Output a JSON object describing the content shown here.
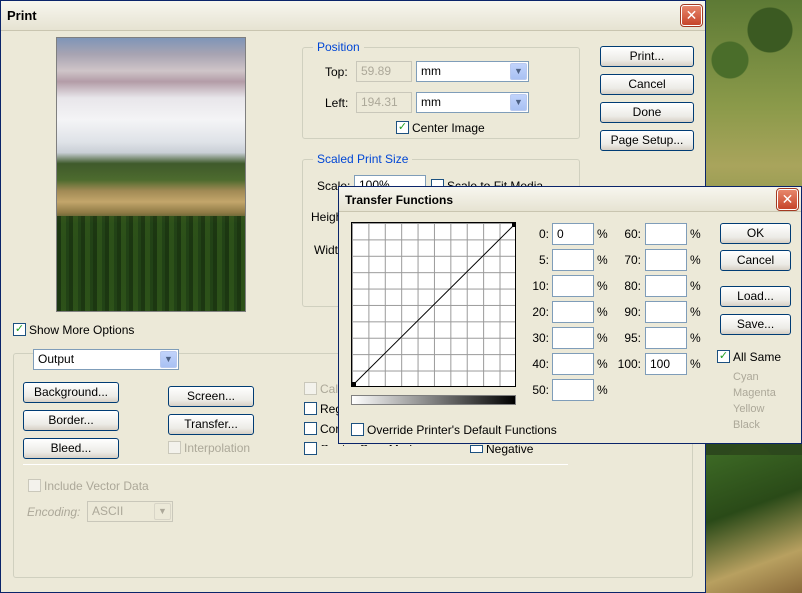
{
  "print_dialog": {
    "title": "Print",
    "position": {
      "legend": "Position",
      "top_label": "Top:",
      "top_value": "59.89",
      "top_unit": "mm",
      "left_label": "Left:",
      "left_value": "194.31",
      "left_unit": "mm",
      "center_image_label": "Center Image",
      "center_image_checked": true
    },
    "scaled_print_size": {
      "legend": "Scaled Print Size",
      "scale_label": "Scale:",
      "scale_value": "100%",
      "scale_to_fit_label": "Scale to Fit Media",
      "height_label": "Height:",
      "width_label": "Width:"
    },
    "buttons": {
      "print": "Print...",
      "cancel": "Cancel",
      "done": "Done",
      "page_setup": "Page Setup..."
    },
    "show_more_options_label": "Show More Options",
    "show_more_options_checked": true,
    "output_select": "Output",
    "output_buttons": {
      "background": "Background...",
      "border": "Border...",
      "bleed": "Bleed...",
      "screen": "Screen...",
      "transfer": "Transfer..."
    },
    "interpolation_label": "Interpolation",
    "right_options": {
      "calibration_bars": "Calibration Bars",
      "registration_marks": "Registration Marks",
      "corner_crop_marks": "Corner Crop Marks",
      "center_crop_marks": "Center Crop Marks",
      "negative": "Negative"
    },
    "include_vector_data_label": "Include Vector Data",
    "encoding_label": "Encoding:",
    "encoding_value": "ASCII"
  },
  "transfer_functions": {
    "title": "Transfer Functions",
    "inputs_left": [
      {
        "label": "0:",
        "value": "0"
      },
      {
        "label": "5:",
        "value": ""
      },
      {
        "label": "10:",
        "value": ""
      },
      {
        "label": "20:",
        "value": ""
      },
      {
        "label": "30:",
        "value": ""
      },
      {
        "label": "40:",
        "value": ""
      },
      {
        "label": "50:",
        "value": ""
      }
    ],
    "inputs_right": [
      {
        "label": "60:",
        "value": ""
      },
      {
        "label": "70:",
        "value": ""
      },
      {
        "label": "80:",
        "value": ""
      },
      {
        "label": "90:",
        "value": ""
      },
      {
        "label": "95:",
        "value": ""
      },
      {
        "label": "100:",
        "value": "100"
      }
    ],
    "percent": "%",
    "ok_label": "OK",
    "cancel_label": "Cancel",
    "load_label": "Load...",
    "save_label": "Save...",
    "all_same_label": "All Same",
    "all_same_checked": true,
    "channels": [
      "Cyan",
      "Magenta",
      "Yellow",
      "Black"
    ],
    "override_label": "Override Printer's Default Functions",
    "override_checked": false
  }
}
